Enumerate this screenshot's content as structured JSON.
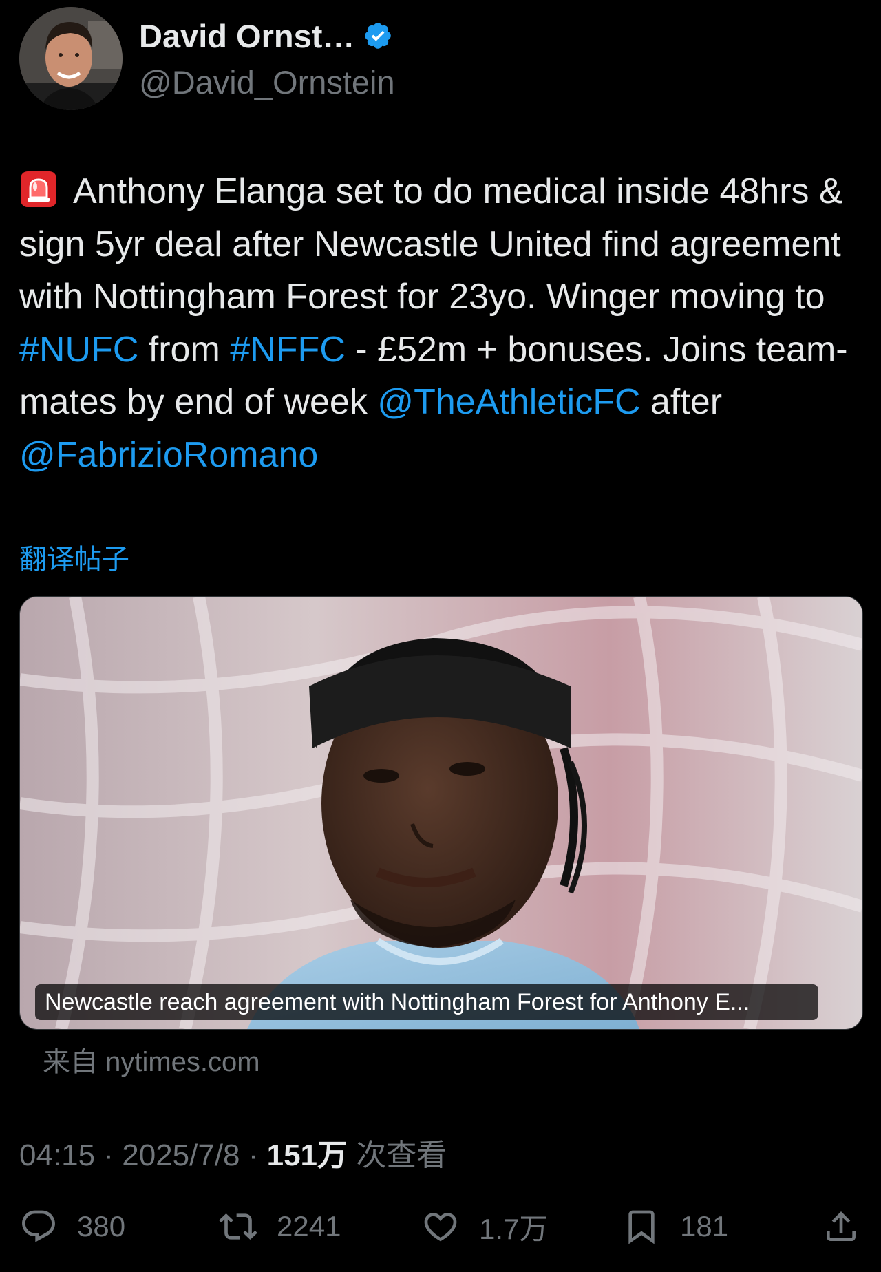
{
  "author": {
    "display_name": "David Ornst…",
    "handle": "@David_Ornstein",
    "verified": true,
    "verified_color": "#1d9bf0"
  },
  "tweet": {
    "alarm_icon": "rotating-light-icon",
    "text_part_1": "Anthony Elanga set to do medical inside 48hrs & sign 5yr deal after Newcastle United find agreement with Nottingham Forest for 23yo. Winger moving to ",
    "hashtag_1": "#NUFC",
    "text_part_2": " from ",
    "hashtag_2": "#NFFC",
    "text_part_3": " - £52m + bonuses. Joins team-mates by end of week ",
    "mention_1": "@TheAthleticFC",
    "text_part_4": " after ",
    "mention_2": "@FabrizioRomano"
  },
  "translate_label": "翻译帖子",
  "link_card": {
    "caption": "Newcastle reach agreement with Nottingham Forest for Anthony E...",
    "source": "来自 nytimes.com"
  },
  "meta": {
    "time": "04:15",
    "separator": " · ",
    "date": "2025/7/8",
    "views_count": "151万",
    "views_label": " 次查看"
  },
  "actions": {
    "replies": "380",
    "reposts": "2241",
    "likes": "1.7万",
    "bookmarks": "181"
  },
  "colors": {
    "background": "#000000",
    "text": "#e7e9ea",
    "secondary": "#71767b",
    "link": "#1d9bf0"
  }
}
